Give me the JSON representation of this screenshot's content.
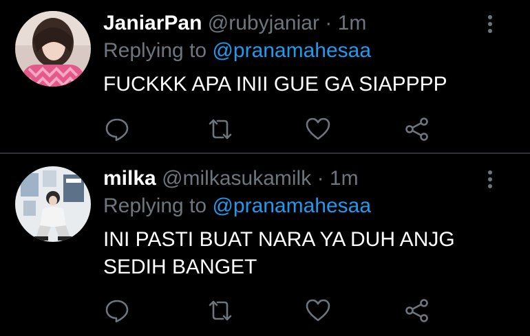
{
  "colors": {
    "background": "#000000",
    "divider": "#2f3336",
    "muted": "#6e767d",
    "link": "#1d9bf0",
    "text": "#ffffff"
  },
  "tweets": [
    {
      "display_name": "JaniarPan",
      "handle": "@rubyjaniar",
      "separator": "·",
      "time": "1m",
      "replying_prefix": "Replying to",
      "replying_to": "@pranamahesaa",
      "text": "FUCKKK APA INII GUE GA SIAPPPP",
      "icons": {
        "more": "more-vertical-icon",
        "reply": "reply-icon",
        "retweet": "retweet-icon",
        "like": "heart-icon",
        "share": "share-icon"
      }
    },
    {
      "display_name": "milka",
      "handle": "@milkasukamilk",
      "separator": "·",
      "time": "1m",
      "replying_prefix": "Replying to",
      "replying_to": "@pranamahesaa",
      "text": "INI PASTI BUAT NARA YA DUH ANJG SEDIH BANGET",
      "icons": {
        "more": "more-vertical-icon",
        "reply": "reply-icon",
        "retweet": "retweet-icon",
        "like": "heart-icon",
        "share": "share-icon"
      }
    }
  ]
}
